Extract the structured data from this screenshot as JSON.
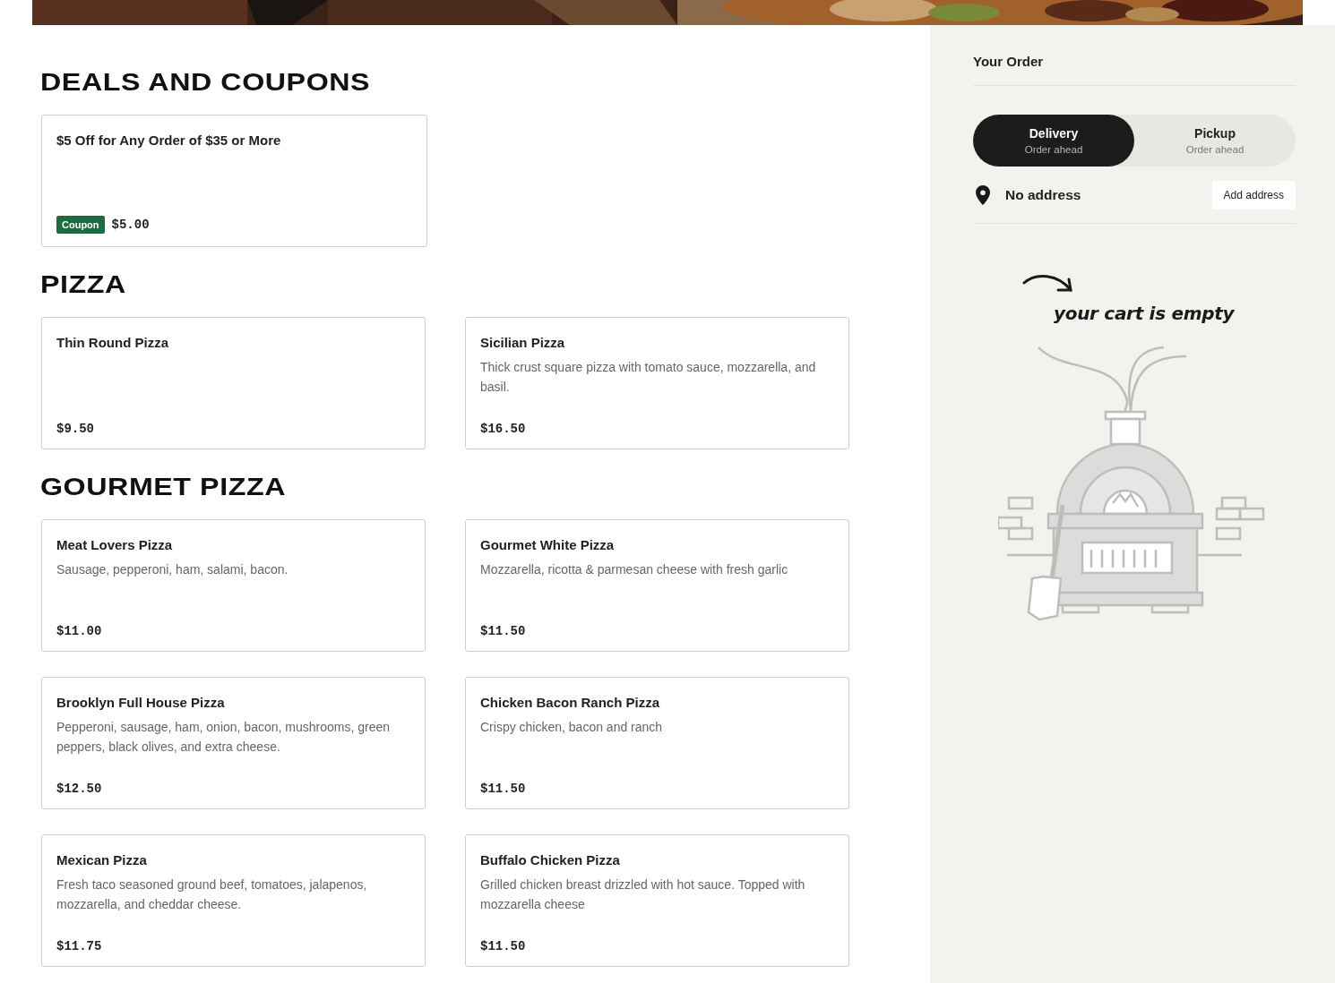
{
  "sections": [
    {
      "title": "DEALS AND COUPONS",
      "items": [
        {
          "name": "$5 Off for Any Order of $35 or More",
          "badge": "Coupon",
          "price": "$5.00"
        }
      ]
    },
    {
      "title": "PIZZA",
      "items": [
        {
          "name": "Thin Round Pizza",
          "price": "$9.50"
        },
        {
          "name": "Sicilian Pizza",
          "description": "Thick crust square pizza with tomato sauce, mozzarella, and basil.",
          "price": "$16.50"
        }
      ]
    },
    {
      "title": "GOURMET PIZZA",
      "items": [
        {
          "name": "Meat Lovers Pizza",
          "description": "Sausage, pepperoni, ham, salami, bacon.",
          "price": "$11.00"
        },
        {
          "name": "Gourmet White Pizza",
          "description": "Mozzarella, ricotta & parmesan cheese with fresh garlic",
          "price": "$11.50"
        },
        {
          "name": "Brooklyn Full House Pizza",
          "description": "Pepperoni, sausage, ham, onion, bacon, mushrooms, green peppers, black olives, and extra cheese.",
          "price": "$12.50"
        },
        {
          "name": "Chicken Bacon Ranch Pizza",
          "description": "Crispy chicken, bacon and ranch",
          "price": "$11.50"
        },
        {
          "name": "Mexican Pizza",
          "description": "Fresh taco seasoned ground beef, tomatoes, jalapenos, mozzarella, and cheddar cheese.",
          "price": "$11.75"
        },
        {
          "name": "Buffalo Chicken Pizza",
          "description": "Grilled chicken breast drizzled with hot sauce. Topped with mozzarella cheese",
          "price": "$11.50"
        }
      ]
    }
  ],
  "order": {
    "title": "Your Order",
    "modes": [
      {
        "label": "Delivery",
        "sublabel": "Order ahead",
        "selected": true
      },
      {
        "label": "Pickup",
        "sublabel": "Order ahead",
        "selected": false
      }
    ],
    "address": "No address",
    "address_button": "Add address",
    "empty_message": "your cart is empty"
  }
}
